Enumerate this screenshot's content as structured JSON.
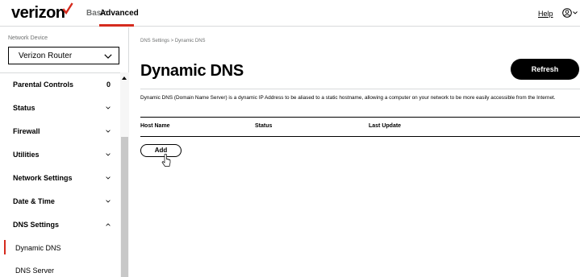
{
  "header": {
    "logo_text": "verizon",
    "tabs": [
      {
        "label": "Basic",
        "active": false
      },
      {
        "label": "Advanced",
        "active": true
      }
    ],
    "help_label": "Help",
    "accent_color": "#d52b1e"
  },
  "sidebar": {
    "device_label": "Network Device",
    "device_selected": "Verizon Router",
    "menu": [
      {
        "label": "Parental Controls",
        "count": "0"
      },
      {
        "label": "Status",
        "icon": "chevron-down-icon"
      },
      {
        "label": "Firewall",
        "icon": "chevron-down-icon"
      },
      {
        "label": "Utilities",
        "icon": "chevron-down-icon"
      },
      {
        "label": "Network Settings",
        "icon": "chevron-down-icon"
      },
      {
        "label": "Date & Time",
        "icon": "chevron-down-icon"
      },
      {
        "label": "DNS Settings",
        "icon": "chevron-up-icon",
        "expanded": true
      }
    ],
    "submenu": [
      {
        "label": "Dynamic DNS",
        "active": true
      },
      {
        "label": "DNS Server",
        "active": false
      }
    ]
  },
  "main": {
    "breadcrumb": "DNS Settings  >  Dynamic DNS",
    "title": "Dynamic DNS",
    "refresh_label": "Refresh",
    "description": "Dynamic DNS (Domain Name Server) is a dynamic IP Address to be aliased to a static hostname, allowing a computer on your network to be more easily accessible from the Internet.",
    "table": {
      "columns": [
        "Host Name",
        "Status",
        "Last Update"
      ],
      "rows": []
    },
    "add_label": "Add"
  }
}
